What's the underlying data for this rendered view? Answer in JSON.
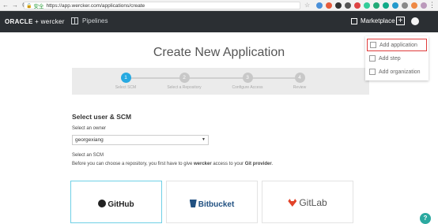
{
  "browser": {
    "back": "←",
    "forward": "→",
    "reload": "C",
    "secure_label": "安全",
    "url": "https://app.wercker.com/applications/create",
    "star": "☆",
    "menu": "⋮"
  },
  "topnav": {
    "logo_oracle": "ORACLE",
    "logo_sep": "+",
    "logo_wercker": "wercker",
    "pipelines": "Pipelines",
    "marketplace": "Marketplace",
    "plus": "+"
  },
  "page": {
    "title": "Create New Application"
  },
  "stepper": {
    "steps": [
      {
        "number": "1",
        "label": "Select SCM",
        "active": true
      },
      {
        "number": "2",
        "label": "Select a Repository",
        "active": false
      },
      {
        "number": "3",
        "label": "Configure Access",
        "active": false
      },
      {
        "number": "4",
        "label": "Review",
        "active": false
      }
    ]
  },
  "form": {
    "section_title": "Select user & SCM",
    "owner_label": "Select an owner",
    "owner_value": "georgexiang",
    "owner_arrow": "▼",
    "scm_label": "Select an SCM",
    "scm_desc_prefix": "Before you can choose a repository, you first have to give ",
    "scm_desc_wercker": "wercker",
    "scm_desc_mid": " access to your ",
    "scm_desc_git": "Git provider",
    "scm_desc_end": "."
  },
  "providers": [
    {
      "name": "GitHub",
      "selected": true
    },
    {
      "name": "Bitbucket",
      "selected": false
    },
    {
      "name": "GitLab",
      "selected": false
    }
  ],
  "dropdown": {
    "items": [
      {
        "label": "Add application",
        "highlight": true
      },
      {
        "label": "Add step",
        "highlight": false
      },
      {
        "label": "Add organization",
        "highlight": false
      }
    ]
  },
  "help": "?",
  "colors": {
    "nav_bg": "#2b2f33",
    "accent": "#27a9e1",
    "highlight_border": "#e03c3c",
    "github": "#222222",
    "bitbucket": "#205081",
    "gitlab": "#e24329"
  }
}
